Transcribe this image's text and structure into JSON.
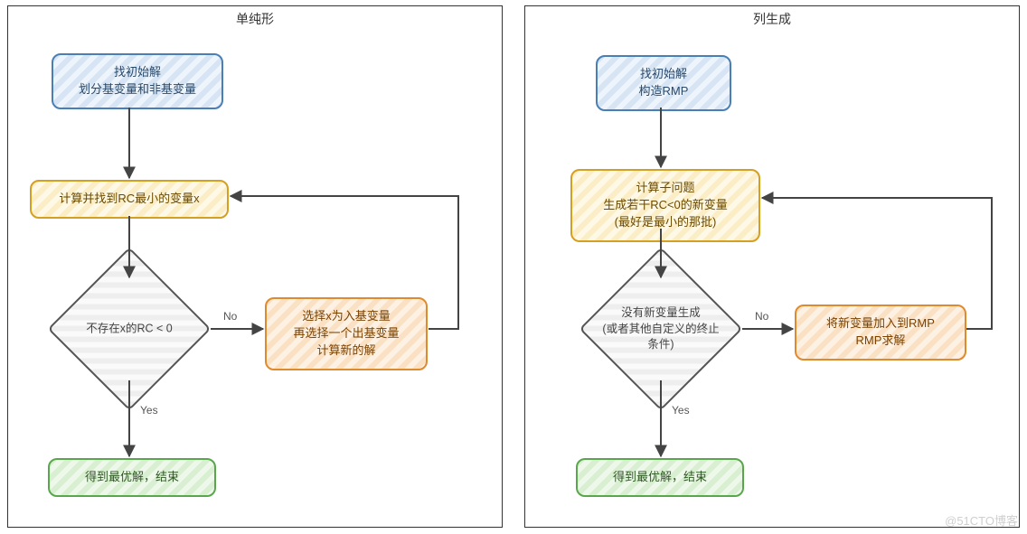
{
  "watermark": "@51CTO博客",
  "left": {
    "title": "单纯形",
    "start": "找初始解\n划分基变量和非基变量",
    "calc": "计算并找到RC最小的变量x",
    "decision": "不存在x的RC < 0",
    "action": "选择x为入基变量\n再选择一个出基变量\n计算新的解",
    "end": "得到最优解，结束",
    "noLabel": "No",
    "yesLabel": "Yes"
  },
  "right": {
    "title": "列生成",
    "start": "找初始解\n构造RMP",
    "calc": "计算子问题\n生成若干RC<0的新变量\n(最好是最小的那批)",
    "decision": "没有新变量生成\n(或者其他自定义的终止\n条件)",
    "action": "将新变量加入到RMP\nRMP求解",
    "end": "得到最优解，结束",
    "noLabel": "No",
    "yesLabel": "Yes"
  }
}
